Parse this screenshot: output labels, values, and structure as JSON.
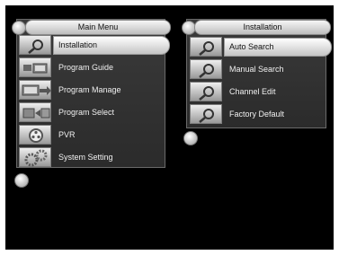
{
  "main_menu": {
    "title": "Main Menu",
    "items": [
      {
        "label": "Installation",
        "icon": "magnifier-icon",
        "selected": true
      },
      {
        "label": "Program Guide",
        "icon": "program-guide-icon"
      },
      {
        "label": "Program Manage",
        "icon": "program-manage-icon"
      },
      {
        "label": "Program Select",
        "icon": "program-select-icon"
      },
      {
        "label": "PVR",
        "icon": "film-reel-icon"
      },
      {
        "label": "System Setting",
        "icon": "gears-icon"
      }
    ]
  },
  "installation_menu": {
    "title": "Installation",
    "items": [
      {
        "label": "Auto Search",
        "icon": "magnifier-icon",
        "selected": true
      },
      {
        "label": "Manual Search",
        "icon": "magnifier-icon"
      },
      {
        "label": "Channel Edit",
        "icon": "magnifier-icon"
      },
      {
        "label": "Factory Default",
        "icon": "magnifier-icon"
      }
    ]
  },
  "colors": {
    "background": "#000000",
    "panel": "#333333",
    "highlight": "#e8e8e8"
  }
}
